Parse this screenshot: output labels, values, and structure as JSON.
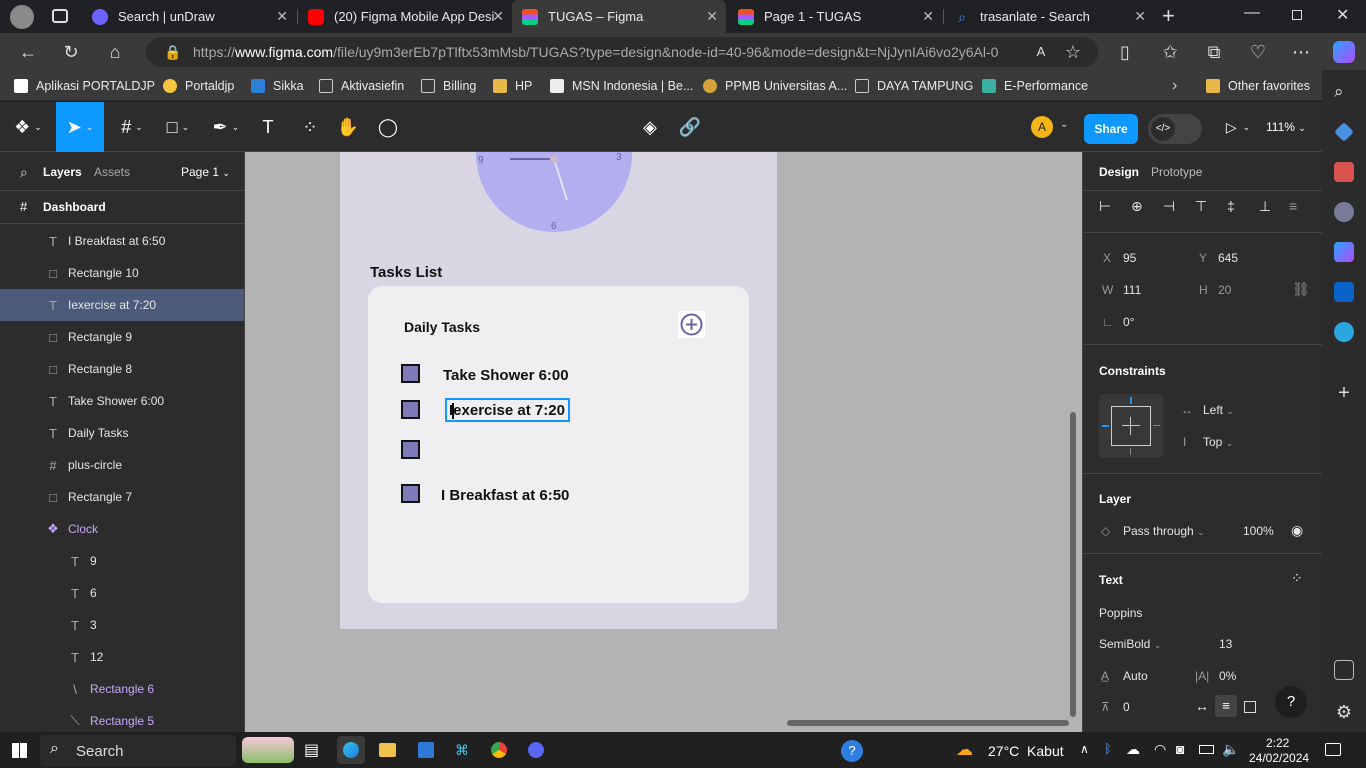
{
  "browser": {
    "tabs": [
      {
        "label": "Search | unDraw",
        "active": false,
        "icon": "undraw-icon",
        "color": "#6c63ff"
      },
      {
        "label": "(20) Figma Mobile App Desi",
        "active": false,
        "icon": "youtube-icon",
        "color": "#ff0000"
      },
      {
        "label": "TUGAS – Figma",
        "active": true,
        "icon": "figma-icon",
        "color": "#f24e1e"
      },
      {
        "label": "Page 1 - TUGAS",
        "active": false,
        "icon": "figma-icon",
        "color": "#f24e1e"
      },
      {
        "label": "trasanlate - Search",
        "active": false,
        "icon": "bing-search-icon",
        "color": "#3d8bfd"
      }
    ],
    "url_prefix": "https://",
    "url_host": "www.figma.com",
    "url_path": "/file/uy9m3erEb7pTlftx53mMsb/TUGAS?type=design&node-id=40-96&mode=design&t=NjJynIAi6vo2y6Al-0",
    "bookmarks": [
      "Aplikasi PORTALDJP",
      "Portaldjp",
      "Sikka",
      "Aktivasiefin",
      "Billing",
      "HP",
      "MSN Indonesia | Be...",
      "PPMB Universitas A...",
      "DAYA TAMPUNG",
      "E-Performance",
      "Other favorites"
    ]
  },
  "figma": {
    "avatar_letter": "A",
    "share_label": "Share",
    "zoom": "111%",
    "left_panel": {
      "tabs": [
        "Layers",
        "Assets"
      ],
      "page": "Page 1",
      "root": "Dashboard",
      "layers": [
        {
          "label": "I Breakfast at 6:50",
          "icon": "T",
          "type": "text"
        },
        {
          "label": "Rectangle 10",
          "icon": "□",
          "type": "rect"
        },
        {
          "label": "Iexercise at 7:20",
          "icon": "T",
          "type": "text",
          "selected": true
        },
        {
          "label": "Rectangle 9",
          "icon": "□",
          "type": "rect"
        },
        {
          "label": "Rectangle 8",
          "icon": "□",
          "type": "rect"
        },
        {
          "label": "Take Shower 6:00",
          "icon": "T",
          "type": "text"
        },
        {
          "label": "Daily Tasks",
          "icon": "T",
          "type": "text"
        },
        {
          "label": "plus-circle",
          "icon": "#",
          "type": "frame"
        },
        {
          "label": "Rectangle 7",
          "icon": "□",
          "type": "rect"
        },
        {
          "label": "Clock",
          "icon": "❖",
          "type": "component"
        },
        {
          "label": "9",
          "icon": "T",
          "type": "text",
          "child": true
        },
        {
          "label": "6",
          "icon": "T",
          "type": "text",
          "child": true
        },
        {
          "label": "3",
          "icon": "T",
          "type": "text",
          "child": true
        },
        {
          "label": "12",
          "icon": "T",
          "type": "text",
          "child": true
        },
        {
          "label": "Rectangle 6",
          "icon": "\\",
          "type": "line",
          "child": true
        },
        {
          "label": "Rectangle 5",
          "icon": "⟍",
          "type": "line",
          "child": true
        }
      ]
    },
    "canvas": {
      "clock_numbers": {
        "nine": "9",
        "three": "3",
        "six": "6"
      },
      "section_title": "Tasks List",
      "card_title": "Daily Tasks",
      "tasks": {
        "t1": "Take Shower 6:00",
        "t2": "Iexercise at 7:20",
        "t4": "I Breakfast at 6:50"
      }
    },
    "right_panel": {
      "tabs": [
        "Design",
        "Prototype"
      ],
      "x_label": "X",
      "x": "95",
      "y_label": "Y",
      "y": "645",
      "w_label": "W",
      "w": "111",
      "h_label": "H",
      "h": "20",
      "rotation": "0°",
      "constraints_title": "Constraints",
      "constraint_h": "Left",
      "constraint_v": "Top",
      "layer_title": "Layer",
      "blend": "Pass through",
      "opacity": "100%",
      "text_title": "Text",
      "font": "Poppins",
      "weight": "SemiBold",
      "size": "13",
      "line_height": "Auto",
      "letter_spacing": "0%",
      "paragraph_spacing": "0",
      "help": "?"
    }
  },
  "taskbar": {
    "search": "Search",
    "weather": "27°C  Kabut",
    "time": "2:22",
    "date": "24/02/2024"
  },
  "colors": {
    "figma_blue": "#0d99ff",
    "selection": "#4b5a7a",
    "checkbox": "#7e7ab8",
    "clock": "#b3aef0",
    "avatar": "#f5b515"
  }
}
